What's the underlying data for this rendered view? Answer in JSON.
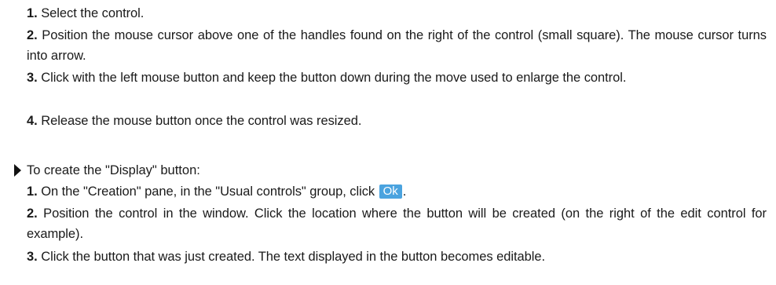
{
  "steps_resize": [
    {
      "num": "1.",
      "text": " Select the control."
    },
    {
      "num": "2.",
      "text": " Position the mouse cursor above one of the handles found on the right of the control (small square). The mouse cursor turns into arrow."
    },
    {
      "num": "3.",
      "text": " Click with the left mouse button and keep the button down during the move used to enlarge the control."
    },
    {
      "num": "4.",
      "text": " Release the mouse button once the control was resized."
    }
  ],
  "bullet": {
    "icon": "triangle-bullet-icon",
    "text": "To create the \"Display\" button:"
  },
  "steps_create": [
    {
      "num": "1.",
      "text_before": " On the \"Creation\" pane, in the \"Usual controls\" group, click ",
      "chip": "Ok",
      "text_after": "."
    },
    {
      "num": "2.",
      "text": " Position the control in the window. Click the location where the button will be created (on the right of the edit control for example)."
    },
    {
      "num": "3.",
      "text": " Click the button that was just created. The text displayed in the button becomes editable."
    }
  ],
  "colors": {
    "ok_chip_bg": "#4aa3df",
    "text": "#1a1a1a"
  }
}
